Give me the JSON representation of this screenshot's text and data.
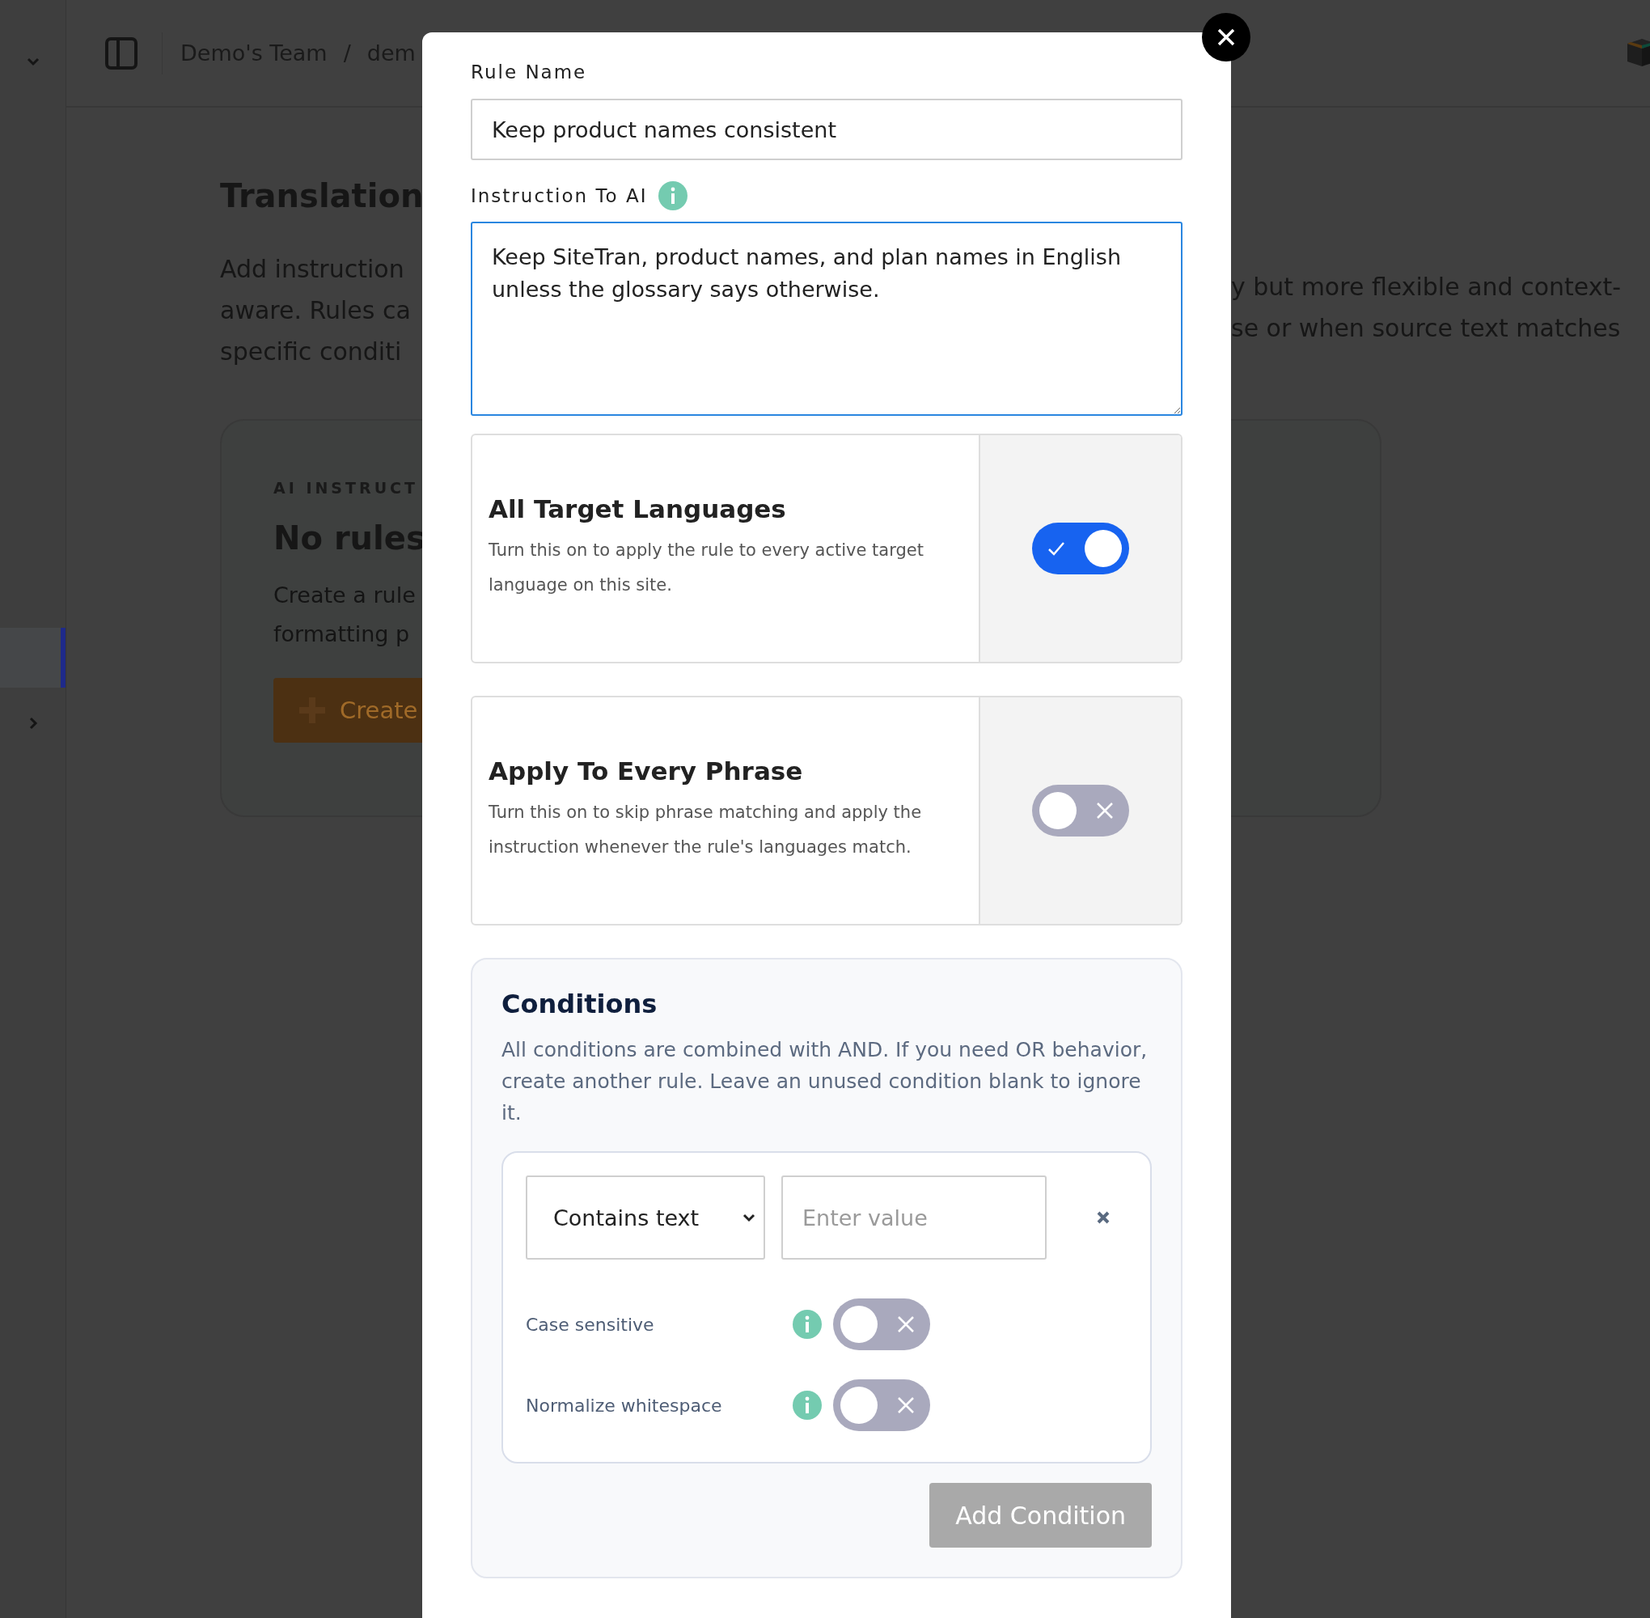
{
  "sidebar": {
    "items": [
      {
        "selected": true
      }
    ]
  },
  "header": {
    "breadcrumb": [
      "Demo's Team",
      "/",
      "dem"
    ]
  },
  "page": {
    "title": "Translation",
    "description_left": [
      "Add instruction",
      "aware. Rules ca",
      "specific conditi"
    ],
    "description_right": [
      "y but more flexible and context-",
      "se or when source text matches"
    ],
    "card": {
      "eyebrow": "AI INSTRUCT",
      "title": "No rules",
      "lines": [
        "Create a rule",
        "formatting p"
      ],
      "button": "Create"
    }
  },
  "modal": {
    "rule_name_label": "Rule Name",
    "rule_name_value": "Keep product names consistent",
    "instruction_label": "Instruction To AI",
    "instruction_value": "Keep SiteTran, product names, and plan names in English unless the glossary says otherwise.",
    "toggles": [
      {
        "title": "All Target Languages",
        "description": "Turn this on to apply the rule to every active target language on this site.",
        "on": true
      },
      {
        "title": "Apply To Every Phrase",
        "description": "Turn this on to skip phrase matching and apply the instruction whenever the rule's languages match.",
        "on": false
      }
    ],
    "conditions": {
      "title": "Conditions",
      "description": "All conditions are combined with AND. If you need OR behavior, create another rule. Leave an unused condition blank to ignore it.",
      "rows": [
        {
          "operator": "Contains text",
          "placeholder": "Enter value",
          "options": [
            {
              "label": "Case sensitive",
              "on": false
            },
            {
              "label": "Normalize whitespace",
              "on": false
            }
          ]
        }
      ],
      "add_button": "Add Condition"
    }
  }
}
